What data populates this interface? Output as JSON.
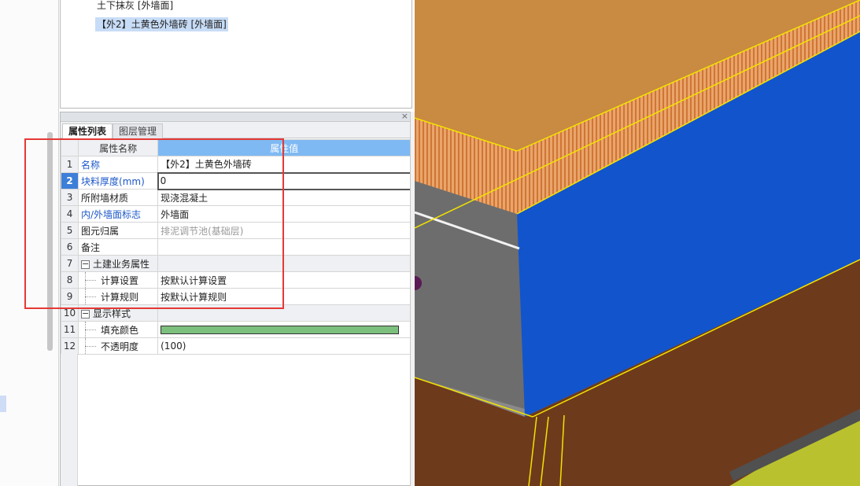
{
  "tree": {
    "items": [
      {
        "label": "土下抹灰 [外墙面]",
        "selected": false
      },
      {
        "label": "【外2】土黄色外墙砖 [外墙面]",
        "selected": true
      }
    ]
  },
  "panel": {
    "close_icon": "×",
    "tabs": [
      "属性列表",
      "图层管理"
    ],
    "active_tab": 0
  },
  "grid": {
    "header_name": "属性名称",
    "header_value": "属性值",
    "rows": [
      {
        "num": "1",
        "name": "名称",
        "value": "【外2】土黄色外墙砖"
      },
      {
        "num": "2",
        "name": "块料厚度(mm)",
        "value": "0"
      },
      {
        "num": "3",
        "name": "所附墙材质",
        "value": "现浇混凝土"
      },
      {
        "num": "4",
        "name": "内/外墙面标志",
        "value": "外墙面"
      },
      {
        "num": "5",
        "name": "图元归属",
        "value": "排泥调节池(基础层)"
      },
      {
        "num": "6",
        "name": "备注",
        "value": ""
      },
      {
        "num": "7",
        "name": "土建业务属性",
        "value": ""
      },
      {
        "num": "8",
        "name": "计算设置",
        "value": "按默认计算设置"
      },
      {
        "num": "9",
        "name": "计算规则",
        "value": "按默认计算规则"
      },
      {
        "num": "10",
        "name": "显示样式",
        "value": ""
      },
      {
        "num": "11",
        "name": "填充颜色",
        "value": ""
      },
      {
        "num": "12",
        "name": "不透明度",
        "value": "(100)"
      }
    ],
    "expand_symbol": "−"
  },
  "colors": {
    "fill_color": "#7dc07e",
    "highlight": "#e53935",
    "selected_row": "#3d7fd8",
    "header_value_bg": "#7fb9f3"
  }
}
